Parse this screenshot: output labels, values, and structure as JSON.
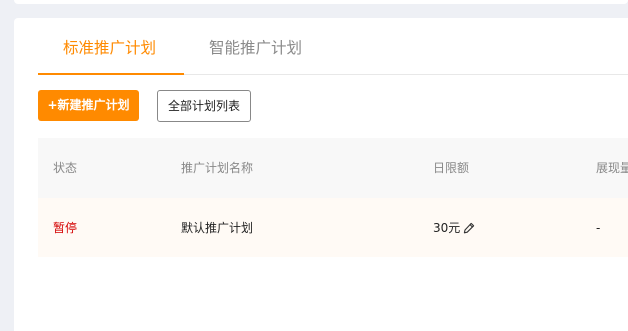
{
  "tabs": [
    {
      "label": "标准推广计划",
      "active": true
    },
    {
      "label": "智能推广计划",
      "active": false
    }
  ],
  "toolbar": {
    "new_plan_label": "+新建推广计划",
    "all_plans_label": "全部计划列表"
  },
  "table": {
    "columns": [
      "状态",
      "推广计划名称",
      "日限额",
      "展现量"
    ],
    "rows": [
      {
        "status": "暂停",
        "name": "默认推广计划",
        "daily_limit": "30元",
        "impressions": "-"
      }
    ]
  },
  "icons": {
    "edit": "pencil-icon"
  },
  "colors": {
    "accent": "#ff8a00",
    "status_paused": "#d40000",
    "row_highlight": "#fffaf5",
    "header_bg": "#f8f8f8"
  }
}
